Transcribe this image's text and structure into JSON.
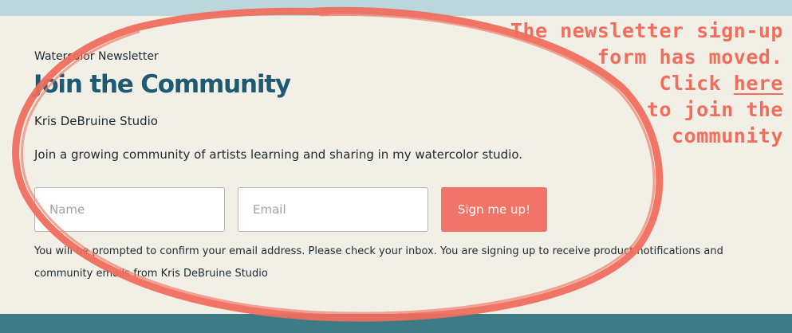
{
  "colors": {
    "background": "#f1efe6",
    "top_bar": "#bcd7dc",
    "bottom_bar": "#3f7b86",
    "title": "#1f5a73",
    "accent": "#f07568",
    "annotation": "#ef6e5d"
  },
  "header": {
    "eyebrow": "Watercolor Newsletter",
    "title": "Join the Community",
    "studio": "Kris DeBruine Studio",
    "description": "Join a growing community of artists learning and sharing in my watercolor studio."
  },
  "form": {
    "name_placeholder": "Name",
    "email_placeholder": "Email",
    "name_value": "",
    "email_value": "",
    "submit_label": "Sign me up!",
    "fine_print": "You will be prompted to confirm your email address. Please check your inbox. You are signing up to receive product notifications and community emails from Kris DeBruine Studio"
  },
  "notice": {
    "line1": "The newsletter sign-up",
    "line2": "form has moved.",
    "line3_prefix": "Click ",
    "link_text": "here",
    "line4": "to join the",
    "line5": "community"
  }
}
